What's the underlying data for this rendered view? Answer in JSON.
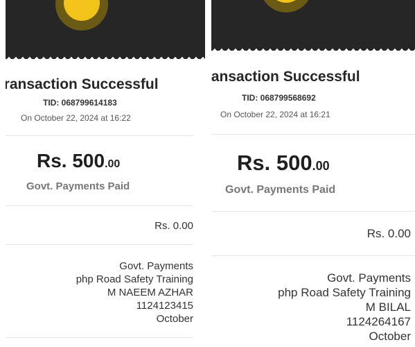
{
  "receipts": [
    {
      "title": "Transaction Successful",
      "tid": "TID: 068799614183",
      "datetime": "On October 22, 2024 at 16:22",
      "amount_main": "Rs. 500",
      "amount_decimals": ".00",
      "status": "Govt. Payments Paid",
      "fee": "Rs. 0.00",
      "details": [
        "Govt. Payments",
        "php Road Safety Training",
        "M NAEEM AZHAR",
        "1124123415",
        "October"
      ]
    },
    {
      "title": "Transaction Successful",
      "tid": "TID: 068799568692",
      "datetime": "On October 22, 2024 at 16:21",
      "amount_main": "Rs. 500",
      "amount_decimals": ".00",
      "status": "Govt. Payments Paid",
      "fee": "Rs. 0.00",
      "details": [
        "Govt. Payments",
        "php Road Safety Training",
        "M BILAL",
        "1124264167",
        "October"
      ]
    }
  ],
  "icons": {
    "success": "checkmark-circle-icon"
  },
  "colors": {
    "banner": "#262626",
    "accent": "#f2c318",
    "muted_text": "#777777"
  }
}
